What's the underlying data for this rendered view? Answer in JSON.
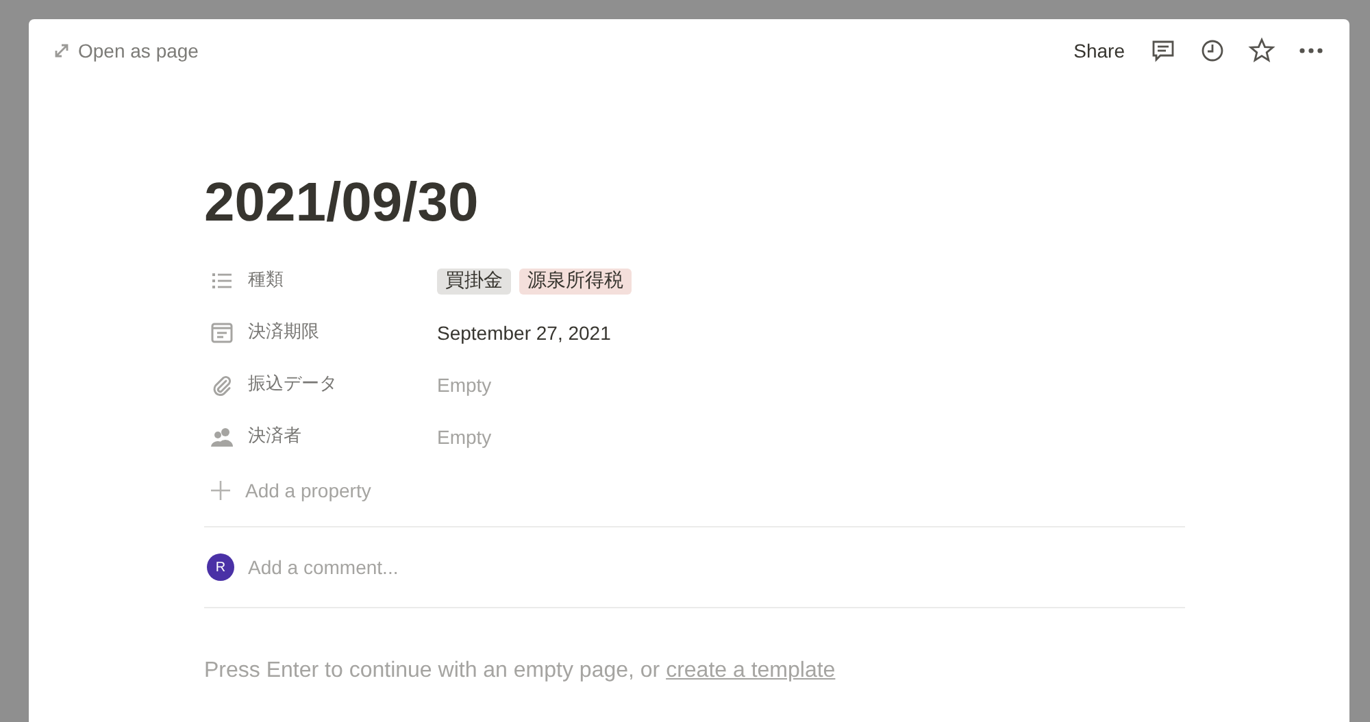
{
  "topbar": {
    "open_as_page": "Open as page",
    "share": "Share"
  },
  "title": "2021/09/30",
  "properties": [
    {
      "name": "種類",
      "kind": "tags",
      "tags": [
        {
          "label": "買掛金",
          "color": "#e3e2e0"
        },
        {
          "label": "源泉所得税",
          "color": "#f4dfdb"
        }
      ]
    },
    {
      "name": "決済期限",
      "kind": "date",
      "value": "September 27, 2021"
    },
    {
      "name": "振込データ",
      "kind": "files",
      "value": "Empty"
    },
    {
      "name": "決済者",
      "kind": "person",
      "value": "Empty"
    }
  ],
  "add_property": "Add a property",
  "comment": {
    "avatar": "R",
    "placeholder": "Add a comment..."
  },
  "hint": {
    "text": "Press Enter to continue with an empty page, or",
    "link": "create a template"
  }
}
